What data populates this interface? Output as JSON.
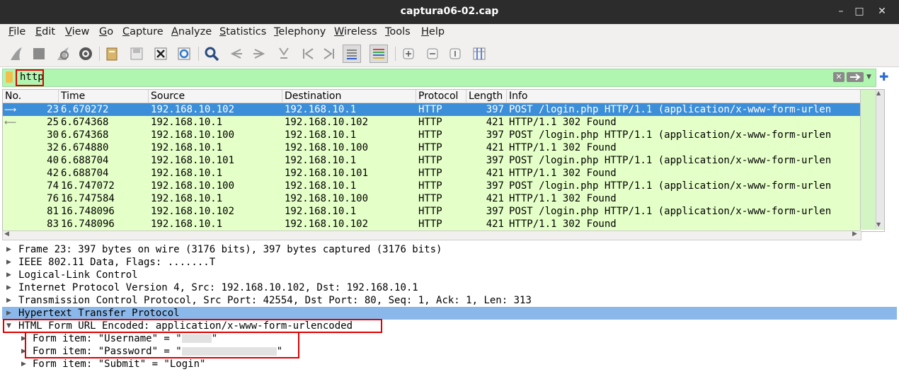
{
  "window": {
    "title": "captura06-02.cap",
    "minimize": "–",
    "maximize": "□",
    "close": "✕"
  },
  "menu": [
    "File",
    "Edit",
    "View",
    "Go",
    "Capture",
    "Analyze",
    "Statistics",
    "Telephony",
    "Wireless",
    "Tools",
    "Help"
  ],
  "toolbar_icons": [
    "shark-fin-start-icon",
    "stop-capture-icon",
    "restart-capture-icon",
    "capture-options-icon",
    "open-file-icon",
    "save-file-icon",
    "close-file-icon",
    "reload-file-icon",
    "find-packet-icon",
    "go-back-icon",
    "go-forward-icon",
    "go-to-packet-icon",
    "first-packet-icon",
    "last-packet-icon",
    "auto-scroll-icon",
    "colorize-icon",
    "zoom-in-icon",
    "zoom-out-icon",
    "normal-size-icon",
    "resize-columns-icon"
  ],
  "filter": {
    "value": "http"
  },
  "columns": [
    "No.",
    "Time",
    "Source",
    "Destination",
    "Protocol",
    "Length",
    "Info"
  ],
  "packets": [
    {
      "no": "23",
      "time": "6.670272",
      "src": "192.168.10.102",
      "dst": "192.168.10.1",
      "proto": "HTTP",
      "len": "397",
      "info": "POST /login.php HTTP/1.1  (application/x-www-form-urlen"
    },
    {
      "no": "25",
      "time": "6.674368",
      "src": "192.168.10.1",
      "dst": "192.168.10.102",
      "proto": "HTTP",
      "len": "421",
      "info": "HTTP/1.1 302 Found"
    },
    {
      "no": "30",
      "time": "6.674368",
      "src": "192.168.10.100",
      "dst": "192.168.10.1",
      "proto": "HTTP",
      "len": "397",
      "info": "POST /login.php HTTP/1.1  (application/x-www-form-urlen"
    },
    {
      "no": "32",
      "time": "6.674880",
      "src": "192.168.10.1",
      "dst": "192.168.10.100",
      "proto": "HTTP",
      "len": "421",
      "info": "HTTP/1.1 302 Found"
    },
    {
      "no": "40",
      "time": "6.688704",
      "src": "192.168.10.101",
      "dst": "192.168.10.1",
      "proto": "HTTP",
      "len": "397",
      "info": "POST /login.php HTTP/1.1  (application/x-www-form-urlen"
    },
    {
      "no": "42",
      "time": "6.688704",
      "src": "192.168.10.1",
      "dst": "192.168.10.101",
      "proto": "HTTP",
      "len": "421",
      "info": "HTTP/1.1 302 Found"
    },
    {
      "no": "74",
      "time": "16.747072",
      "src": "192.168.10.100",
      "dst": "192.168.10.1",
      "proto": "HTTP",
      "len": "397",
      "info": "POST /login.php HTTP/1.1  (application/x-www-form-urlen"
    },
    {
      "no": "76",
      "time": "16.747584",
      "src": "192.168.10.1",
      "dst": "192.168.10.100",
      "proto": "HTTP",
      "len": "421",
      "info": "HTTP/1.1 302 Found"
    },
    {
      "no": "81",
      "time": "16.748096",
      "src": "192.168.10.102",
      "dst": "192.168.10.1",
      "proto": "HTTP",
      "len": "397",
      "info": "POST /login.php HTTP/1.1  (application/x-www-form-urlen"
    },
    {
      "no": "83",
      "time": "16.748096",
      "src": "192.168.10.1",
      "dst": "192.168.10.102",
      "proto": "HTTP",
      "len": "421",
      "info": "HTTP/1.1 302 Found"
    }
  ],
  "details": [
    "Frame 23: 397 bytes on wire (3176 bits), 397 bytes captured (3176 bits)",
    "IEEE 802.11 Data, Flags: .......T",
    "Logical-Link Control",
    "Internet Protocol Version 4, Src: 192.168.10.102, Dst: 192.168.10.1",
    "Transmission Control Protocol, Src Port: 42554, Dst Port: 80, Seq: 1, Ack: 1, Len: 313",
    "Hypertext Transfer Protocol",
    "HTML Form URL Encoded: application/x-www-form-urlencoded"
  ],
  "form_items": {
    "username_prefix": "Form item: \"Username\" = \"",
    "password_prefix": "Form item: \"Password\" = \"",
    "quote": "\"",
    "submit": "Form item: \"Submit\" = \"Login\""
  }
}
